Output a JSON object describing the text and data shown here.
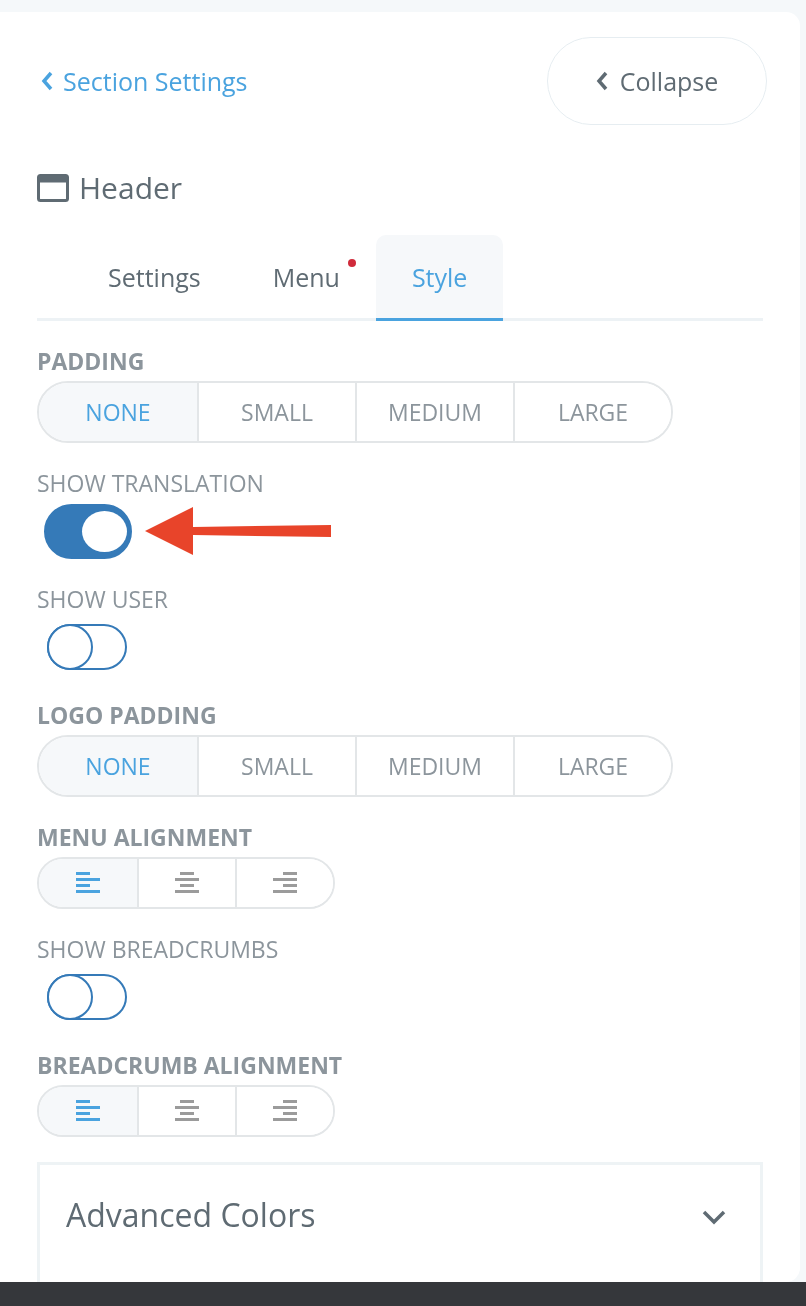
{
  "back_link": {
    "label": "Section Settings"
  },
  "collapse_button": {
    "label": "Collapse"
  },
  "section": {
    "title": "Header"
  },
  "tabs": [
    {
      "label": "Settings",
      "selected": false,
      "has_dot": false
    },
    {
      "label": "Menu",
      "selected": false,
      "has_dot": true
    },
    {
      "label": "Style",
      "selected": true,
      "has_dot": false
    }
  ],
  "fields": [
    {
      "kind": "segmented",
      "label": "PADDING",
      "options": [
        {
          "label": "NONE",
          "selected": true
        },
        {
          "label": "SMALL",
          "selected": false
        },
        {
          "label": "MEDIUM",
          "selected": false
        },
        {
          "label": "LARGE",
          "selected": false
        }
      ]
    },
    {
      "kind": "toggle",
      "label": "SHOW TRANSLATION",
      "on": true,
      "pointed_at": true
    },
    {
      "kind": "toggle",
      "label": "SHOW USER",
      "on": false,
      "pointed_at": false
    },
    {
      "kind": "segmented",
      "label": "LOGO PADDING",
      "options": [
        {
          "label": "NONE",
          "selected": true
        },
        {
          "label": "SMALL",
          "selected": false
        },
        {
          "label": "MEDIUM",
          "selected": false
        },
        {
          "label": "LARGE",
          "selected": false
        }
      ]
    },
    {
      "kind": "align",
      "label": "MENU ALIGNMENT",
      "options": [
        {
          "kind": "left",
          "selected": true
        },
        {
          "kind": "center",
          "selected": false
        },
        {
          "kind": "right",
          "selected": false
        }
      ]
    },
    {
      "kind": "toggle",
      "label": "SHOW BREADCRUMBS",
      "on": false,
      "pointed_at": false
    },
    {
      "kind": "align",
      "label": "BREADCRUMB ALIGNMENT",
      "options": [
        {
          "kind": "left",
          "selected": true
        },
        {
          "kind": "center",
          "selected": false
        },
        {
          "kind": "right",
          "selected": false
        }
      ]
    }
  ],
  "accordion": {
    "title": "Advanced Colors",
    "expanded": false
  }
}
